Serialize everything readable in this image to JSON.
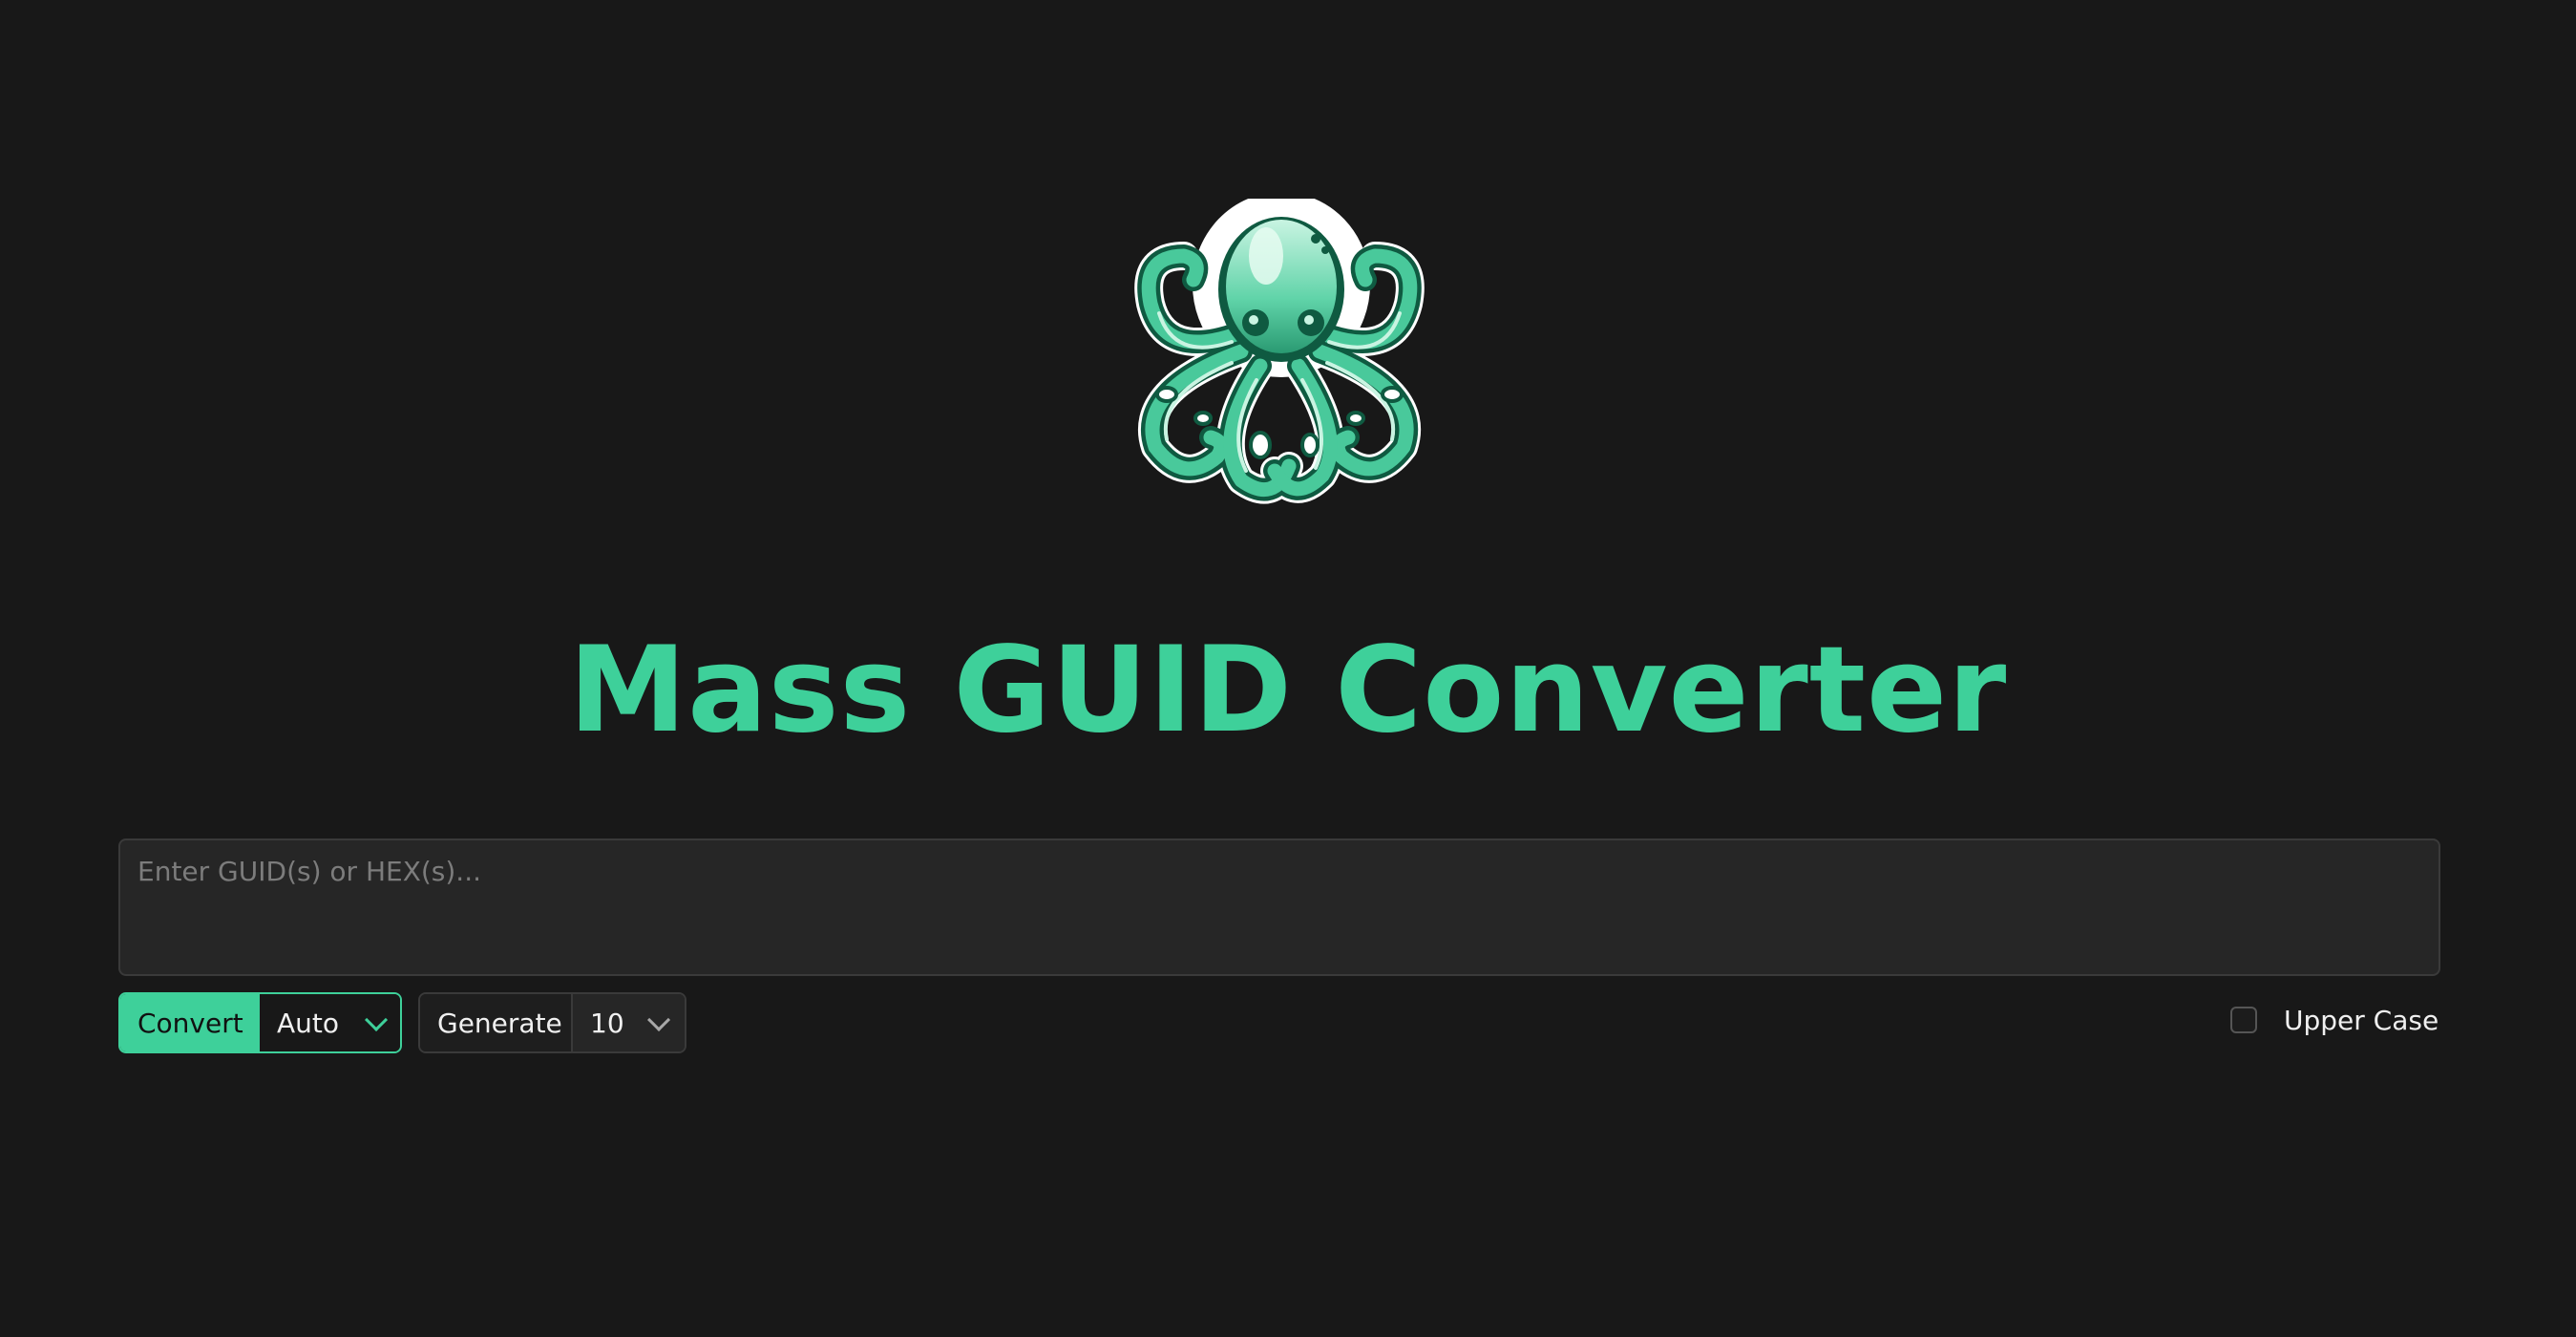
{
  "logo": {
    "icon": "octopus-icon",
    "colors": {
      "body": "#49c99b",
      "highlight": "#c9f4e2",
      "dark": "#0f5a41",
      "outline": "#ffffff"
    }
  },
  "header": {
    "title": "Mass GUID Converter"
  },
  "input": {
    "placeholder": "Enter GUID(s) or HEX(s)...",
    "value": ""
  },
  "toolbar": {
    "convert_label": "Convert",
    "mode_value": "Auto",
    "generate_label": "Generate",
    "count_value": "10",
    "uppercase_label": "Upper Case",
    "uppercase_checked": false
  },
  "colors": {
    "accent": "#3ed09a",
    "background": "#181818",
    "input_background": "#262626"
  }
}
